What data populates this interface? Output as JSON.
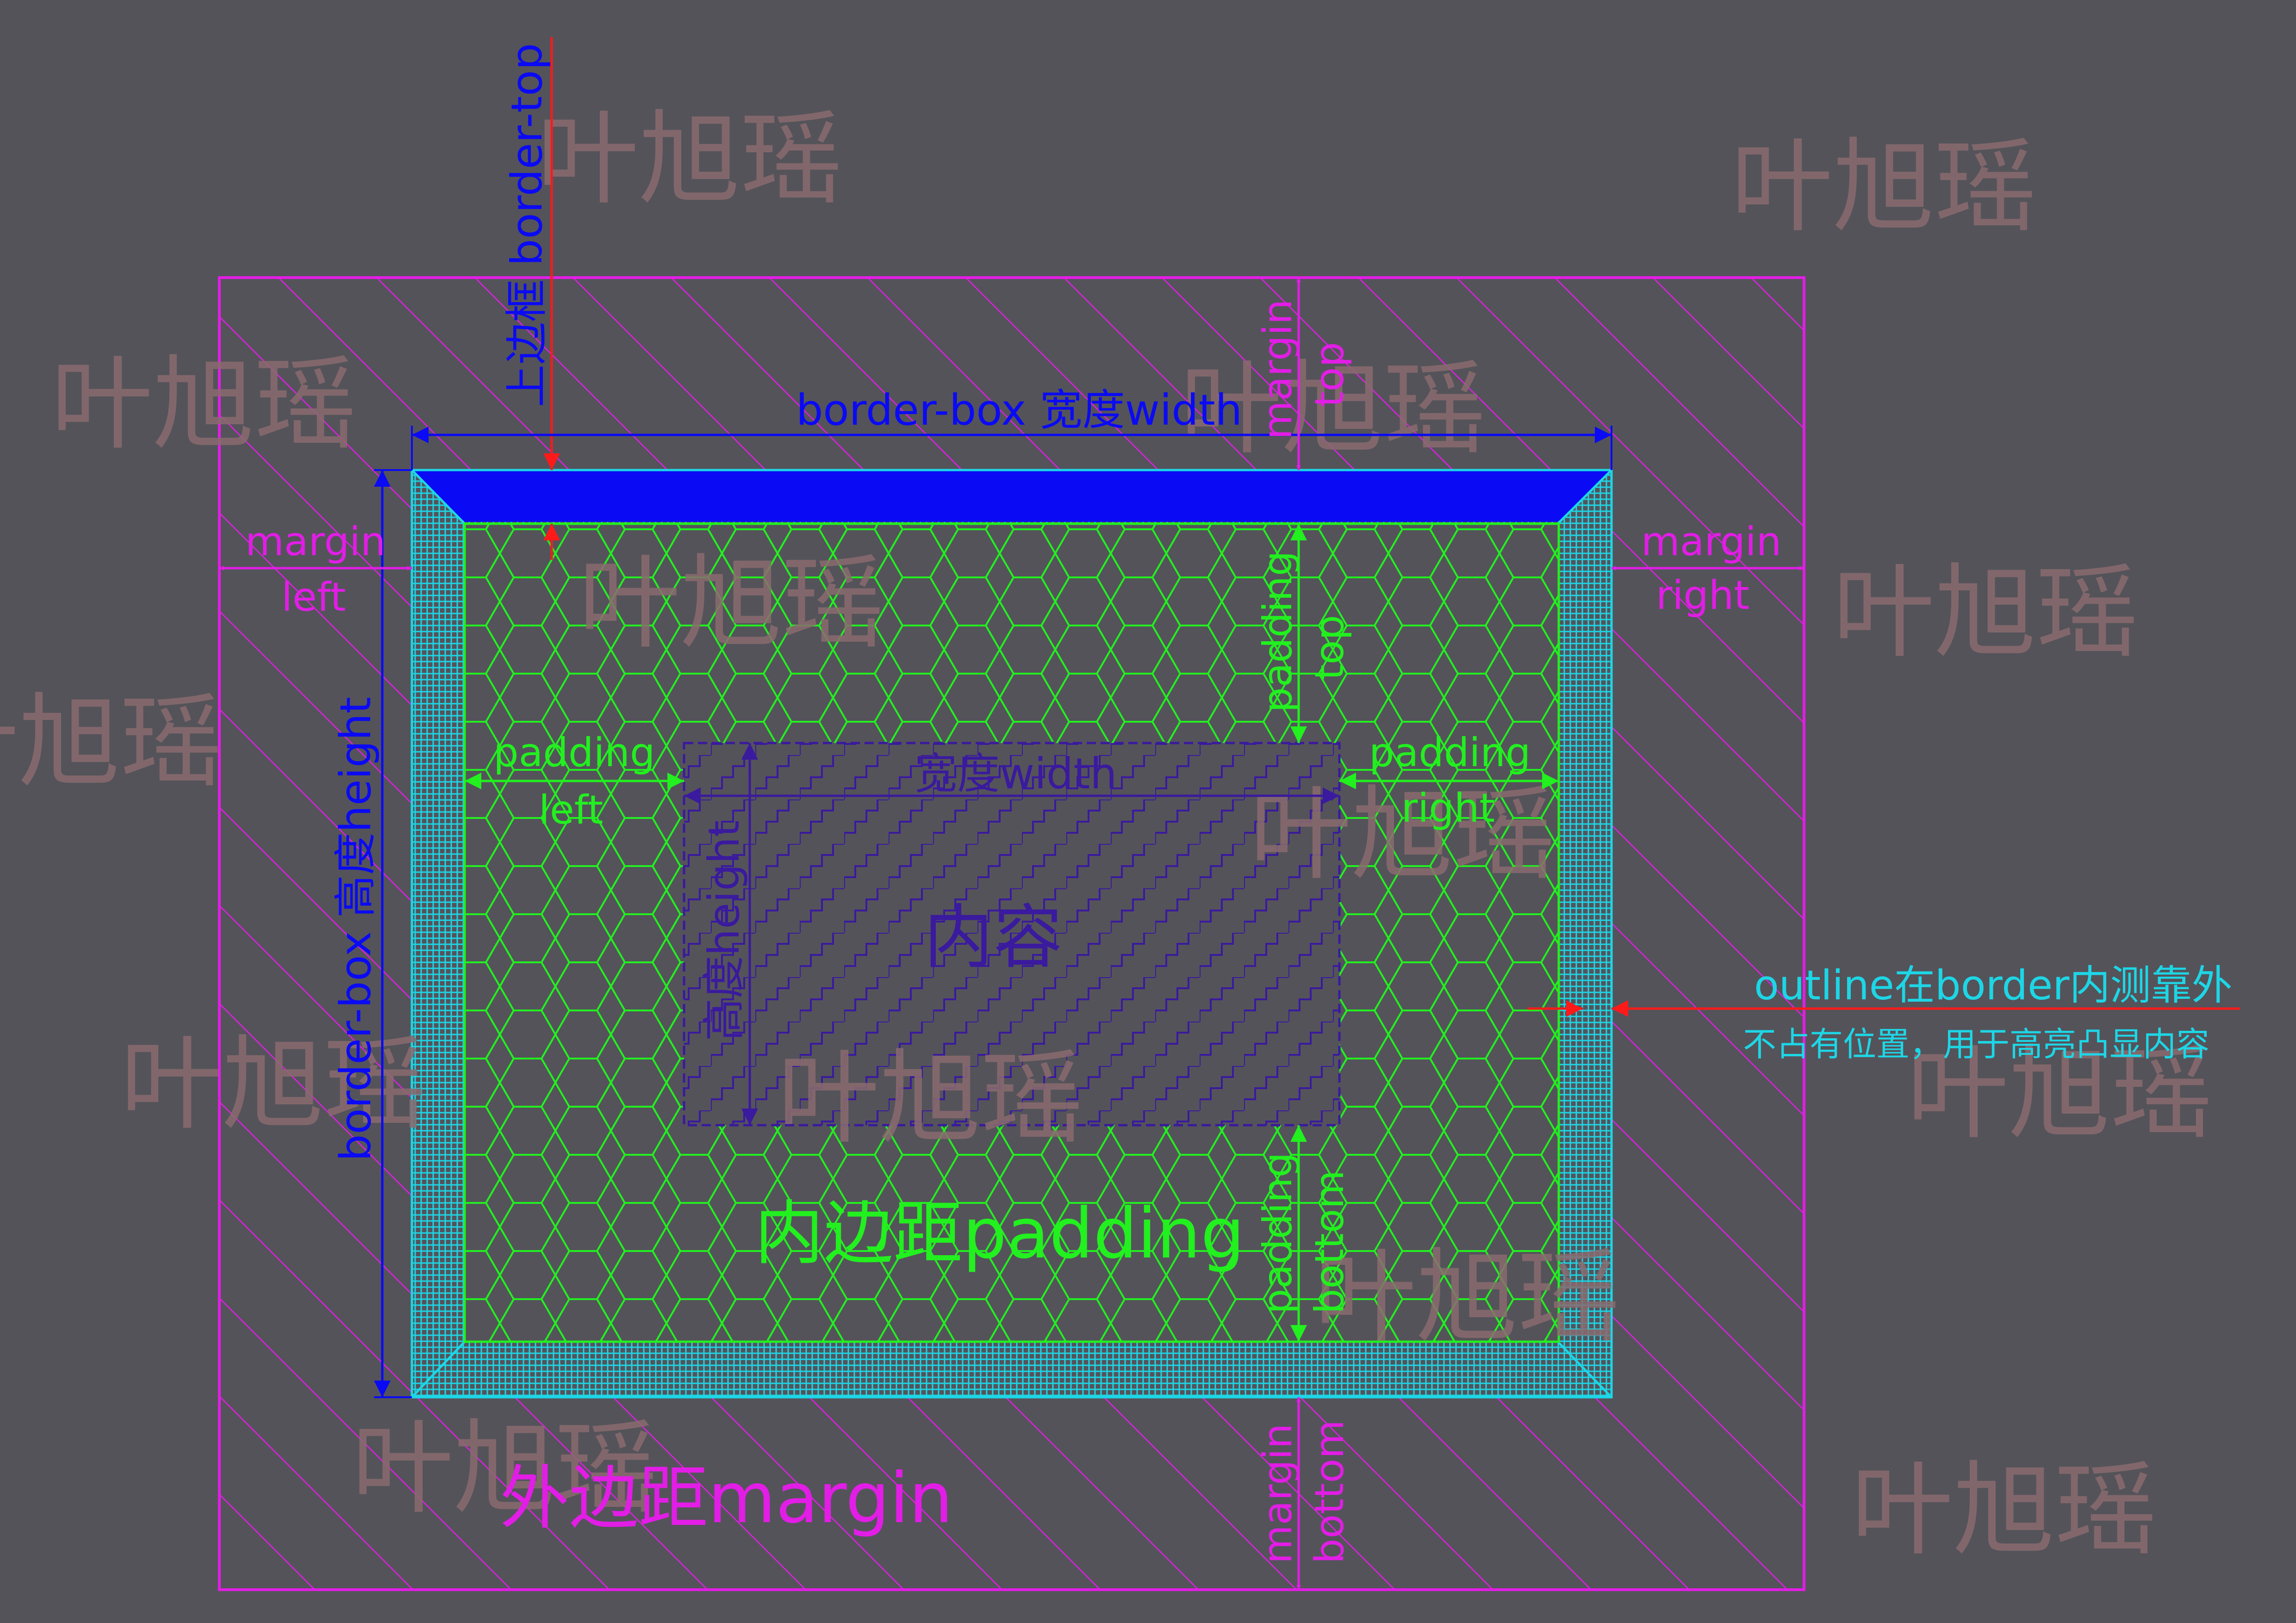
{
  "labels": {
    "border_top": "上边框 border-top",
    "border_box_width": "border-box 宽度width",
    "border_box_height": "border-box 高度height",
    "margin_top": [
      "margin",
      "top"
    ],
    "margin_left": [
      "margin",
      "left"
    ],
    "margin_right": [
      "margin",
      "right"
    ],
    "margin_bottom": [
      "margin",
      "bottom"
    ],
    "padding_top": [
      "padding",
      "top"
    ],
    "padding_left": [
      "padding",
      "left"
    ],
    "padding_right": [
      "padding",
      "right"
    ],
    "padding_bottom": [
      "padding",
      "bottom"
    ],
    "content_width": "宽度width",
    "content_height": "高度height",
    "content": "内容",
    "padding_title": "内边距padding",
    "margin_title": "外边距margin",
    "outline_line1": "outline在border内测靠外",
    "outline_line2": "不占有位置，用于高亮凸显内容"
  },
  "watermark": "叶旭瑶",
  "colors": {
    "background": "#54535a",
    "margin": "#e21de6",
    "border": "#1dd6e6",
    "border_top_fill": "#0a0af4",
    "padding": "#22f01f",
    "content": "#3a1a9e",
    "dimension_blue": "#0a0af4",
    "outline_arrow": "#ff1a1a",
    "outline_text": "#1dd6e6",
    "watermark": "#8a6b6f"
  }
}
